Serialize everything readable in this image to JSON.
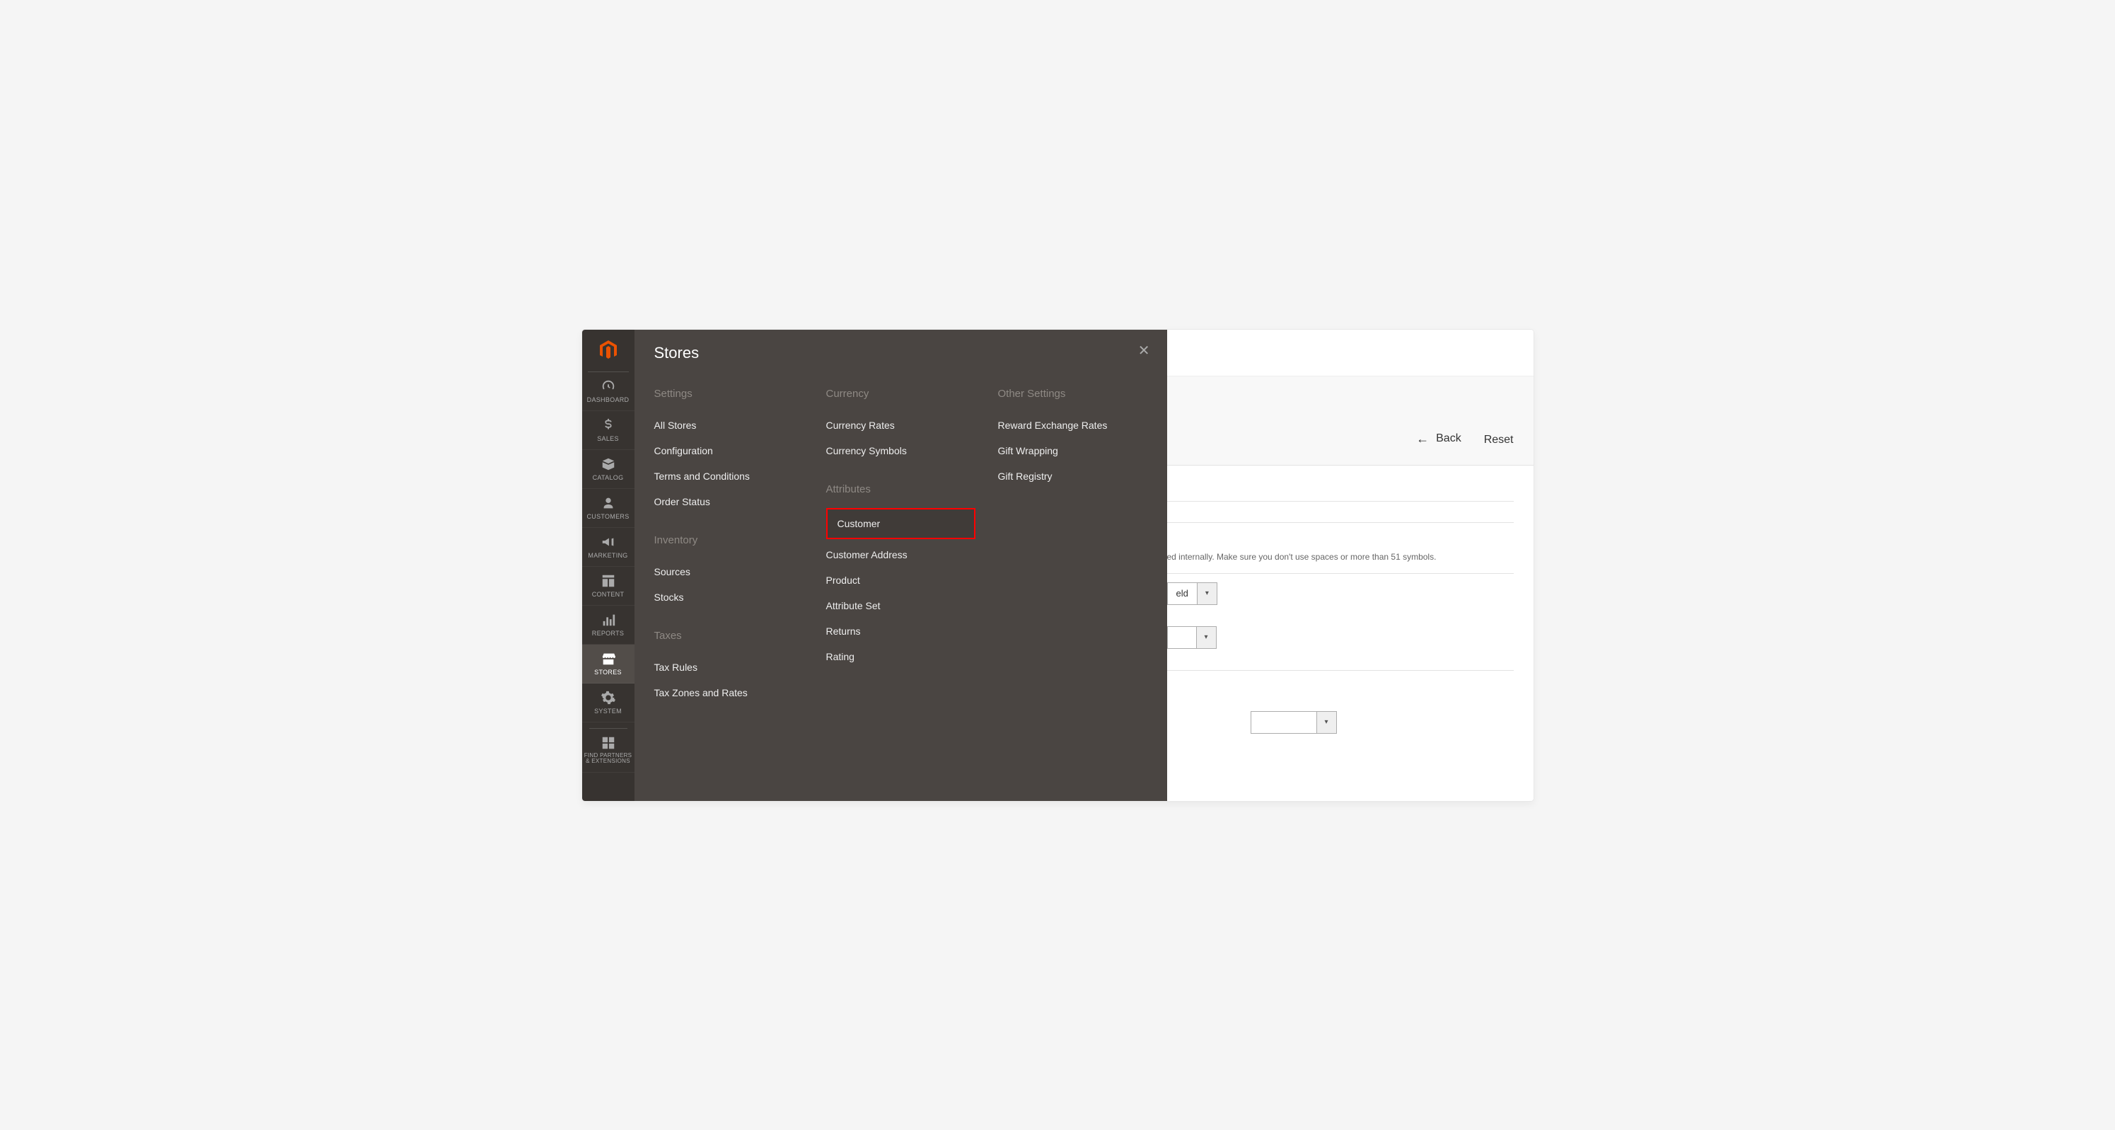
{
  "sidebar": {
    "items": [
      {
        "label": "DASHBOARD",
        "icon": "dashboard"
      },
      {
        "label": "SALES",
        "icon": "dollar"
      },
      {
        "label": "CATALOG",
        "icon": "box"
      },
      {
        "label": "CUSTOMERS",
        "icon": "person"
      },
      {
        "label": "MARKETING",
        "icon": "megaphone"
      },
      {
        "label": "CONTENT",
        "icon": "layout"
      },
      {
        "label": "REPORTS",
        "icon": "bars"
      },
      {
        "label": "STORES",
        "icon": "storefront"
      },
      {
        "label": "SYSTEM",
        "icon": "gear"
      },
      {
        "label": "FIND PARTNERS & EXTENSIONS",
        "icon": "blocks"
      }
    ],
    "active_index": 7
  },
  "flyout": {
    "title": "Stores",
    "columns": [
      {
        "sections": [
          {
            "heading": "Settings",
            "items": [
              "All Stores",
              "Configuration",
              "Terms and Conditions",
              "Order Status"
            ]
          },
          {
            "heading": "Inventory",
            "items": [
              "Sources",
              "Stocks"
            ]
          },
          {
            "heading": "Taxes",
            "items": [
              "Tax Rules",
              "Tax Zones and Rates"
            ]
          }
        ]
      },
      {
        "sections": [
          {
            "heading": "Currency",
            "items": [
              "Currency Rates",
              "Currency Symbols"
            ]
          },
          {
            "heading": "Attributes",
            "items": [
              "Customer",
              "Customer Address",
              "Product",
              "Attribute Set",
              "Returns",
              "Rating"
            ],
            "highlight_index": 0
          }
        ]
      },
      {
        "sections": [
          {
            "heading": "Other Settings",
            "items": [
              "Reward Exchange Rates",
              "Gift Wrapping",
              "Gift Registry"
            ]
          }
        ]
      }
    ]
  },
  "page": {
    "back_label": "Back",
    "reset_label": "Reset",
    "hint_partial": "ed internally. Make sure you don't use spaces or more than 51 symbols.",
    "select1_value_partial": "eld"
  }
}
